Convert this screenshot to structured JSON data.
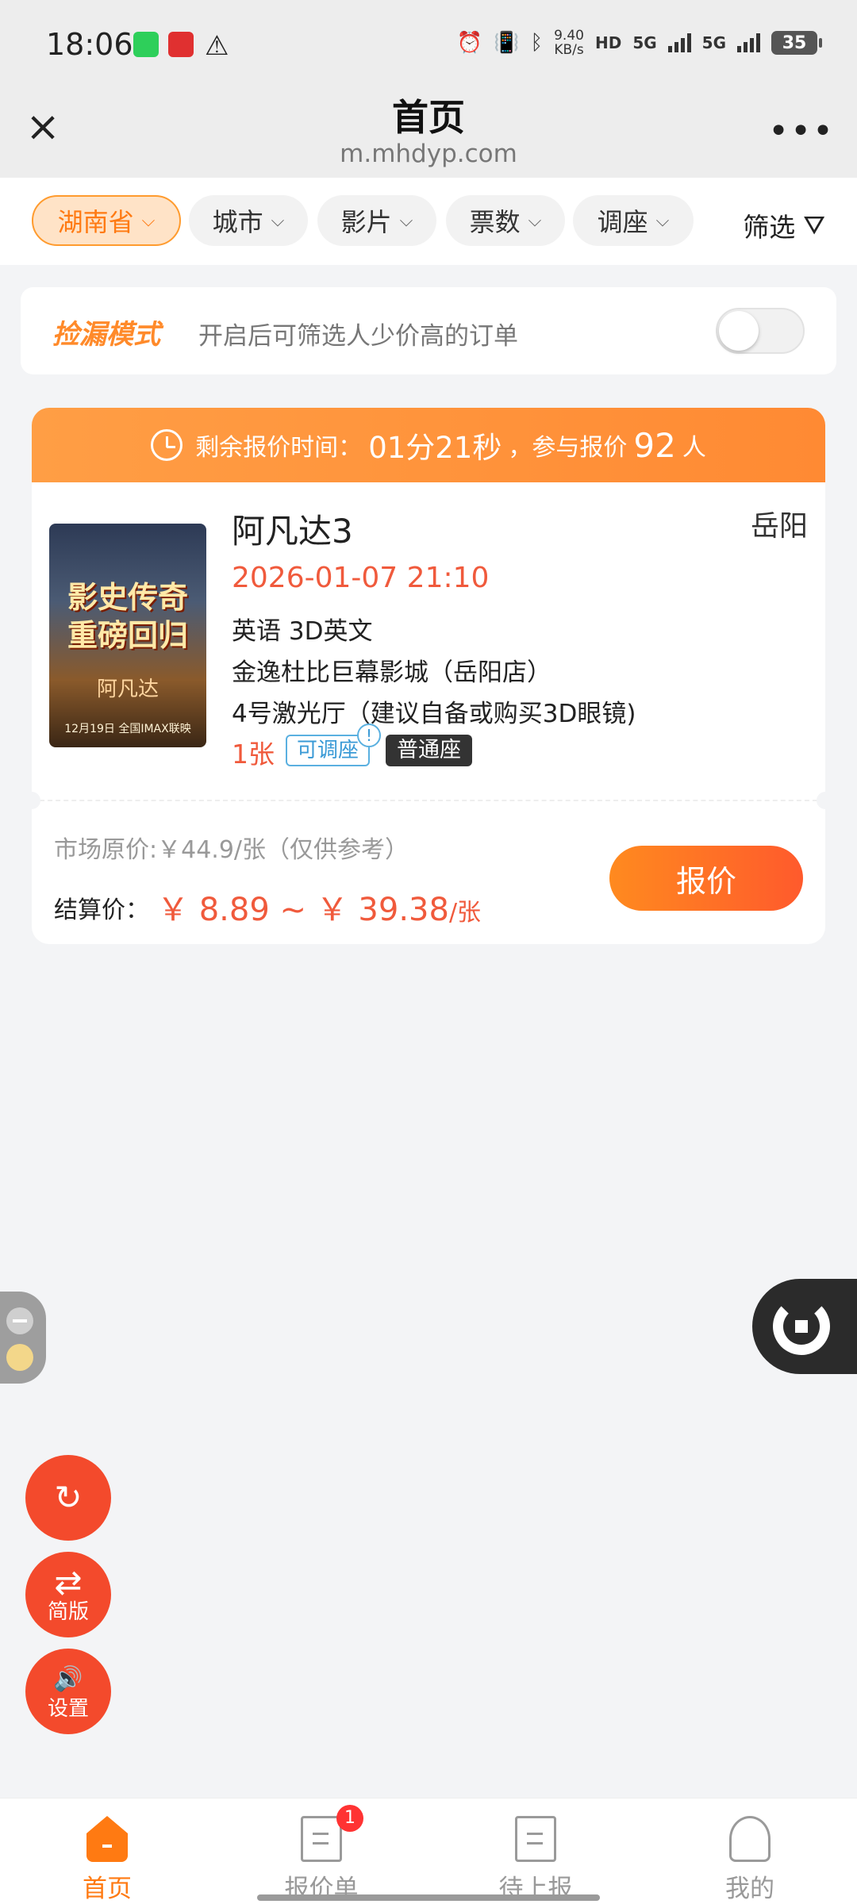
{
  "status_bar": {
    "time": "18:06",
    "network_speed": "9.40",
    "network_speed_unit": "KB/s",
    "hd_label": "HD",
    "signal_1": "5G",
    "signal_2": "5G",
    "battery": "35",
    "icons": [
      "alarm-icon",
      "vibrate-icon",
      "bluetooth-icon",
      "warning-icon"
    ]
  },
  "header": {
    "title": "首页",
    "url": "m.mhdyp.com",
    "close_icon": "×",
    "more_icon": "•••"
  },
  "filters": {
    "province": "湖南省",
    "city": "城市",
    "movie": "影片",
    "tickets": "票数",
    "seat_adjust": "调座",
    "filter": "筛选",
    "chevron": "⌵",
    "filter_icon": "⛛"
  },
  "mode": {
    "title": "捡漏模式",
    "description": "开启后可筛选人少价高的订单",
    "toggle_on": false
  },
  "order": {
    "time_label": "剩余报价时间：",
    "countdown": "01分21秒",
    "participants_prefix": "，参与报价",
    "participants": "92",
    "participants_suffix": "人",
    "poster": {
      "line1": "影史传奇",
      "line2": "重磅回归",
      "name": "阿凡达",
      "date": "12月19日 全国IMAX联映"
    },
    "movie_title": "阿凡达3",
    "city": "岳阳",
    "datetime": "2026-01-07 21:10",
    "language": "英语 3D英文",
    "cinema": "金逸杜比巨幕影城（岳阳店）",
    "hall": "4号激光厅（建议自备或购买3D眼镜)",
    "ticket_count": "1张",
    "seat_tag": "可调座",
    "info_mark": "!",
    "seat_type": "普通座",
    "market_price": "市场原价:￥44.9/张（仅供参考）",
    "settle_label": "结算价：",
    "settle_range": "￥ 8.89 ~ ￥ 39.38",
    "settle_unit": "/张",
    "quote_button": "报价"
  },
  "floating": {
    "refresh_icon": "↻",
    "simple_icon": "⇄",
    "simple_label": "简版",
    "settings_icon": "🔊",
    "settings_label": "设置"
  },
  "bottom_nav": {
    "items": [
      {
        "label": "首页",
        "active": true
      },
      {
        "label": "报价单",
        "badge": "1"
      },
      {
        "label": "待上报"
      },
      {
        "label": "我的"
      }
    ]
  },
  "colors": {
    "accent": "#ff7a12",
    "price_red": "#f05a3c",
    "fab_red": "#f34a2c"
  }
}
